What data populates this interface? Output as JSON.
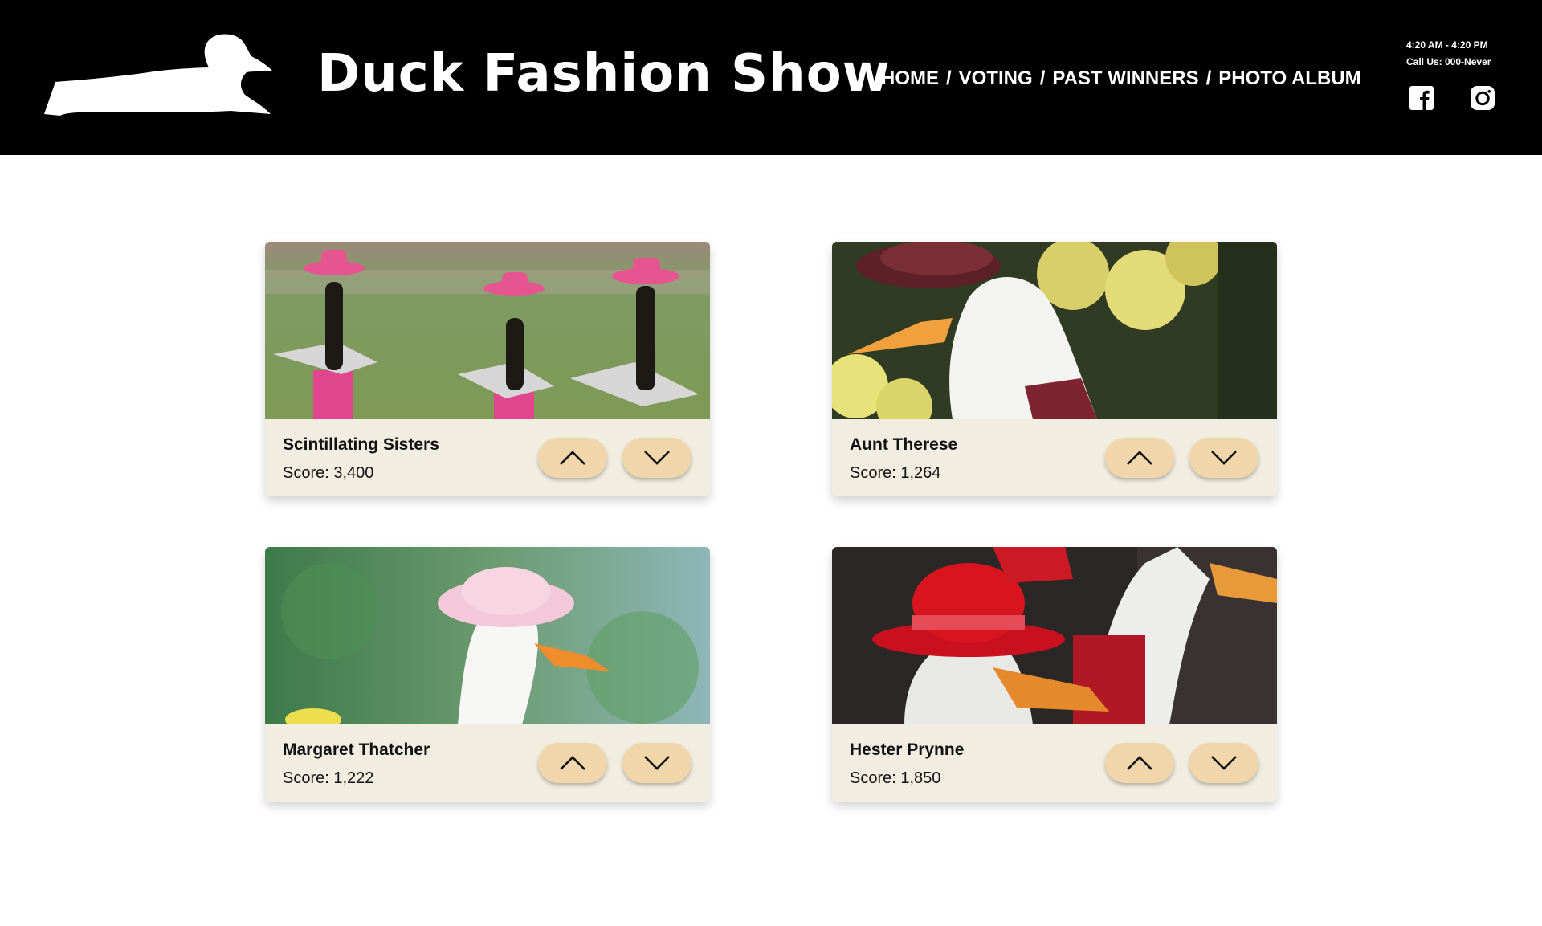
{
  "header": {
    "title": "Duck Fashion Show",
    "nav": [
      {
        "label": "HOME"
      },
      {
        "label": "VOTING"
      },
      {
        "label": "PAST WINNERS"
      },
      {
        "label": "PHOTO ALBUM"
      }
    ],
    "nav_separator": "/",
    "hours": "4:20 AM - 4:20 PM",
    "phone": "Call Us: 000-Never",
    "social": [
      {
        "icon": "facebook-icon"
      },
      {
        "icon": "instagram-icon"
      }
    ]
  },
  "colors": {
    "header_bg": "#000000",
    "card_bg": "#f1ede0",
    "vote_button": "#f0d6aa"
  },
  "contestants": [
    {
      "name": "Scintillating Sisters",
      "score": "Score: 3,400"
    },
    {
      "name": "Aunt Therese",
      "score": "Score: 1,264"
    },
    {
      "name": "Margaret Thatcher",
      "score": "Score: 1,222"
    },
    {
      "name": "Hester Prynne",
      "score": "Score: 1,850"
    }
  ],
  "vote_icons": {
    "up": "chevron-up-icon",
    "down": "chevron-down-icon"
  }
}
